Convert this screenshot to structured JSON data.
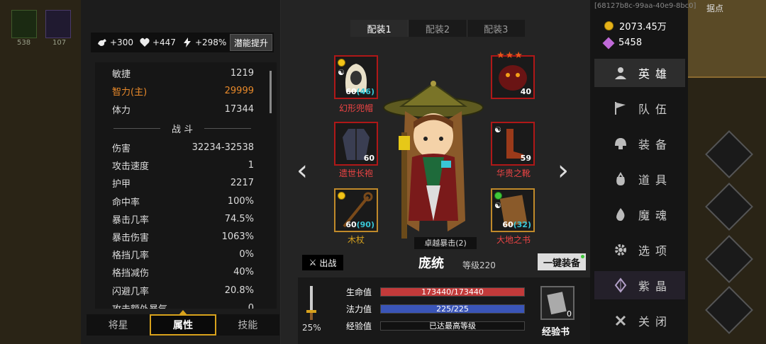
{
  "world": {
    "tile1_count": "538",
    "tile2_count": "107",
    "top_right_label": "据点"
  },
  "stat_top": {
    "strength": "+300",
    "health": "+447",
    "energy": "+298%",
    "upgrade_label": "潜能提升"
  },
  "stats": {
    "rows": [
      {
        "label": "敏捷",
        "value": "1219"
      },
      {
        "label": "智力(主)",
        "value": "29999"
      },
      {
        "label": "体力",
        "value": "17344"
      }
    ],
    "section": "战 斗",
    "combat": [
      {
        "label": "伤害",
        "value": "32234-32538"
      },
      {
        "label": "攻击速度",
        "value": "1"
      },
      {
        "label": "护甲",
        "value": "2217"
      },
      {
        "label": "命中率",
        "value": "100%"
      },
      {
        "label": "暴击几率",
        "value": "74.5%"
      },
      {
        "label": "暴击伤害",
        "value": "1063%"
      },
      {
        "label": "格挡几率",
        "value": "0%"
      },
      {
        "label": "格挡减伤",
        "value": "40%"
      },
      {
        "label": "闪避几率",
        "value": "20.8%"
      },
      {
        "label": "攻击额外暴气",
        "value": "0"
      }
    ]
  },
  "bottom_tabs": [
    "将星",
    "属性",
    "技能"
  ],
  "loadouts": [
    "配装1",
    "配装2",
    "配装3"
  ],
  "equipment": {
    "helm": {
      "name": "幻形兜帽",
      "level": "60",
      "bonus": "(46)"
    },
    "armor": {
      "name": "遗世长袍",
      "level": "60"
    },
    "weapon": {
      "name": "木杖",
      "level": "60",
      "bonus": "(90)"
    },
    "mount": {
      "level": "40",
      "stars": "★★★"
    },
    "boots": {
      "name": "华贵之靴",
      "level": "59"
    },
    "book": {
      "name": "大地之书",
      "level": "60",
      "bonus": "(32)"
    }
  },
  "hero": {
    "buff": "卓越暴击(2)",
    "sortie": "出战",
    "name": "庞统",
    "level": "等级220",
    "equip_all": "一键装备"
  },
  "bars": {
    "weapon_pct": "25%",
    "hp_label": "生命值",
    "hp_text": "173440/173440",
    "hp_fill": 1.0,
    "mp_label": "法力值",
    "mp_text": "225/225",
    "mp_fill": 1.0,
    "exp_label": "经验值",
    "exp_text": "已达最高等级"
  },
  "exp_book": {
    "count": "0",
    "label": "经验书"
  },
  "right_panel": {
    "uid": "[68127b8c-99aa-40e9-8bc0]",
    "gold": "2073.45万",
    "gems": "5458",
    "menu": [
      "英雄",
      "队伍",
      "装备",
      "道具",
      "魔魂",
      "选项",
      "紫晶",
      "关闭"
    ]
  },
  "colors": {
    "hp": "#c23a3a",
    "mp": "#3a55b8",
    "accent": "#d8a21c",
    "primary_stat": "#e8892a"
  }
}
